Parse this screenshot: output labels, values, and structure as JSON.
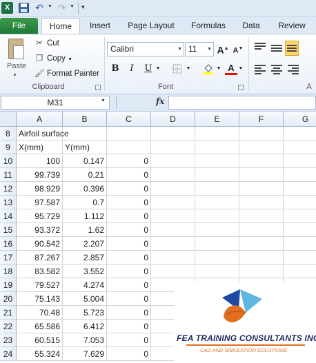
{
  "qat": {
    "app_icon_letter": "X"
  },
  "tabs": [
    "File",
    "Home",
    "Insert",
    "Page Layout",
    "Formulas",
    "Data",
    "Review"
  ],
  "clipboard": {
    "paste": "Paste",
    "cut": "Cut",
    "copy": "Copy",
    "format_painter": "Format Painter",
    "group_label": "Clipboard"
  },
  "font": {
    "name": "Calibri",
    "size": "11",
    "grow": "A",
    "shrink": "A",
    "bold": "B",
    "italic": "I",
    "underline": "U",
    "font_color_letter": "A",
    "group_label": "Font",
    "highlight_color": "#ffff00",
    "font_color": "#ff0000"
  },
  "alignment": {
    "group_label": "A"
  },
  "formula_bar": {
    "name_box": "M31",
    "fx": "fx",
    "formula": ""
  },
  "columns": [
    "A",
    "B",
    "C",
    "D",
    "E",
    "F",
    "G"
  ],
  "rows": [
    {
      "num": "8",
      "A": "Airfoil surface",
      "B": "",
      "C": ""
    },
    {
      "num": "9",
      "A": "X(mm)",
      "B": "Y(mm)",
      "C": ""
    },
    {
      "num": "10",
      "A": "100",
      "B": "0.147",
      "C": "0"
    },
    {
      "num": "11",
      "A": "99.739",
      "B": "0.21",
      "C": "0"
    },
    {
      "num": "12",
      "A": "98.929",
      "B": "0.396",
      "C": "0"
    },
    {
      "num": "13",
      "A": "97.587",
      "B": "0.7",
      "C": "0"
    },
    {
      "num": "14",
      "A": "95.729",
      "B": "1.112",
      "C": "0"
    },
    {
      "num": "15",
      "A": "93.372",
      "B": "1.62",
      "C": "0"
    },
    {
      "num": "16",
      "A": "90.542",
      "B": "2.207",
      "C": "0"
    },
    {
      "num": "17",
      "A": "87.267",
      "B": "2.857",
      "C": "0"
    },
    {
      "num": "18",
      "A": "83.582",
      "B": "3.552",
      "C": "0"
    },
    {
      "num": "19",
      "A": "79.527",
      "B": "4.274",
      "C": "0"
    },
    {
      "num": "20",
      "A": "75.143",
      "B": "5.004",
      "C": "0"
    },
    {
      "num": "21",
      "A": "70.48",
      "B": "5.723",
      "C": "0"
    },
    {
      "num": "22",
      "A": "65.586",
      "B": "6.412",
      "C": "0"
    },
    {
      "num": "23",
      "A": "60.515",
      "B": "7.053",
      "C": "0"
    },
    {
      "num": "24",
      "A": "55.324",
      "B": "7.629",
      "C": "0"
    }
  ],
  "logo": {
    "title": "FEA TRAINING CONSULTANTS INC.",
    "subtitle": "CAD AND SIMULATION SOLUTIONS"
  },
  "colors": {
    "excel_green": "#1e7145",
    "ribbon_blue": "#dfe9f5",
    "logo_orange": "#e07020",
    "logo_blue": "#1c2a5e"
  }
}
